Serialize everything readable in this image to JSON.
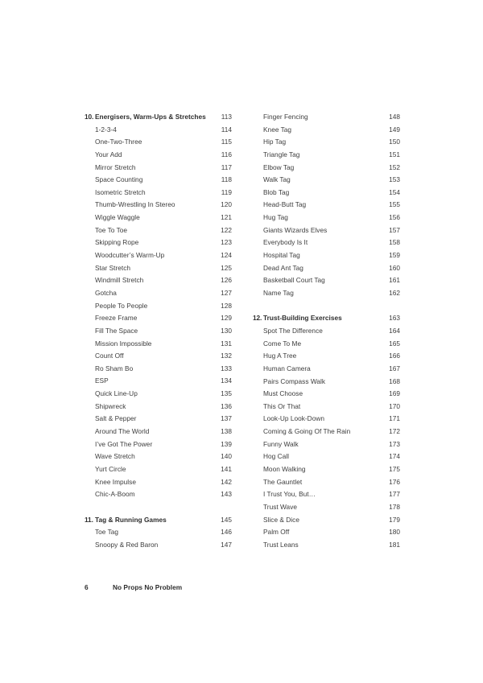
{
  "document": {
    "type": "table-of-contents",
    "book_title": "No Props No Problem",
    "folio": "6"
  },
  "columns": [
    {
      "sections": [
        {
          "chapter_number": "10.",
          "chapter_title": "Energisers, Warm-Ups & Stretches",
          "chapter_page": "113",
          "entries": [
            {
              "title": "1-2-3-4",
              "page": "114"
            },
            {
              "title": "One-Two-Three",
              "page": "115"
            },
            {
              "title": "Your Add",
              "page": "116"
            },
            {
              "title": "Mirror Stretch",
              "page": "117"
            },
            {
              "title": "Space Counting",
              "page": "118"
            },
            {
              "title": "Isometric Stretch",
              "page": "119"
            },
            {
              "title": "Thumb-Wrestling In Stereo",
              "page": "120"
            },
            {
              "title": "Wiggle Waggle",
              "page": "121"
            },
            {
              "title": "Toe To Toe",
              "page": "122"
            },
            {
              "title": "Skipping Rope",
              "page": "123"
            },
            {
              "title": "Woodcutter’s Warm-Up",
              "page": "124"
            },
            {
              "title": "Star Stretch",
              "page": "125"
            },
            {
              "title": "Windmill Stretch",
              "page": "126"
            },
            {
              "title": "Gotcha",
              "page": "127"
            },
            {
              "title": "People To People",
              "page": "128"
            },
            {
              "title": "Freeze Frame",
              "page": "129"
            },
            {
              "title": "Fill The Space",
              "page": "130"
            },
            {
              "title": "Mission Impossible",
              "page": "131"
            },
            {
              "title": "Count Off",
              "page": "132"
            },
            {
              "title": "Ro Sham Bo",
              "page": "133"
            },
            {
              "title": "ESP",
              "page": "134"
            },
            {
              "title": "Quick Line-Up",
              "page": "135"
            },
            {
              "title": "Shipwreck",
              "page": "136"
            },
            {
              "title": "Salt & Pepper",
              "page": "137"
            },
            {
              "title": "Around The World",
              "page": "138"
            },
            {
              "title": "I’ve Got The Power",
              "page": "139"
            },
            {
              "title": "Wave Stretch",
              "page": "140"
            },
            {
              "title": "Yurt Circle",
              "page": "141"
            },
            {
              "title": "Knee Impulse",
              "page": "142"
            },
            {
              "title": "Chic-A-Boom",
              "page": "143"
            }
          ]
        },
        {
          "chapter_number": "11.",
          "chapter_title": "Tag & Running Games",
          "chapter_page": "145",
          "entries": [
            {
              "title": "Toe Tag",
              "page": "146"
            },
            {
              "title": "Snoopy & Red Baron",
              "page": "147"
            }
          ]
        }
      ]
    },
    {
      "sections": [
        {
          "chapter_number": "",
          "chapter_title": "",
          "chapter_page": "",
          "continuation": true,
          "entries": [
            {
              "title": "Finger Fencing",
              "page": "148"
            },
            {
              "title": "Knee Tag",
              "page": "149"
            },
            {
              "title": "Hip Tag",
              "page": "150"
            },
            {
              "title": "Triangle Tag",
              "page": "151"
            },
            {
              "title": "Elbow Tag",
              "page": "152"
            },
            {
              "title": "Walk Tag",
              "page": "153"
            },
            {
              "title": "Blob Tag",
              "page": "154"
            },
            {
              "title": "Head-Butt Tag",
              "page": "155"
            },
            {
              "title": "Hug Tag",
              "page": "156"
            },
            {
              "title": "Giants Wizards Elves",
              "page": "157"
            },
            {
              "title": "Everybody Is It",
              "page": "158"
            },
            {
              "title": "Hospital Tag",
              "page": "159"
            },
            {
              "title": "Dead Ant Tag",
              "page": "160"
            },
            {
              "title": "Basketball Court Tag",
              "page": "161"
            },
            {
              "title": "Name Tag",
              "page": "162"
            }
          ]
        },
        {
          "chapter_number": "12.",
          "chapter_title": "Trust-Building Exercises",
          "chapter_page": "163",
          "entries": [
            {
              "title": "Spot The Difference",
              "page": "164"
            },
            {
              "title": "Come To Me",
              "page": "165"
            },
            {
              "title": "Hug A Tree",
              "page": "166"
            },
            {
              "title": "Human Camera",
              "page": "167"
            },
            {
              "title": "Pairs Compass Walk",
              "page": "168"
            },
            {
              "title": "Must Choose",
              "page": "169"
            },
            {
              "title": "This Or That",
              "page": "170"
            },
            {
              "title": "Look-Up Look-Down",
              "page": "171"
            },
            {
              "title": "Coming & Going Of The Rain",
              "page": "172"
            },
            {
              "title": "Funny Walk",
              "page": "173"
            },
            {
              "title": "Hog Call",
              "page": "174"
            },
            {
              "title": "Moon Walking",
              "page": "175"
            },
            {
              "title": "The Gauntlet",
              "page": "176"
            },
            {
              "title": "I Trust You, But…",
              "page": "177"
            },
            {
              "title": "Trust Wave",
              "page": "178"
            },
            {
              "title": "Slice & Dice",
              "page": "179"
            },
            {
              "title": "Palm Off",
              "page": "180"
            },
            {
              "title": "Trust Leans",
              "page": "181"
            }
          ]
        }
      ]
    }
  ]
}
